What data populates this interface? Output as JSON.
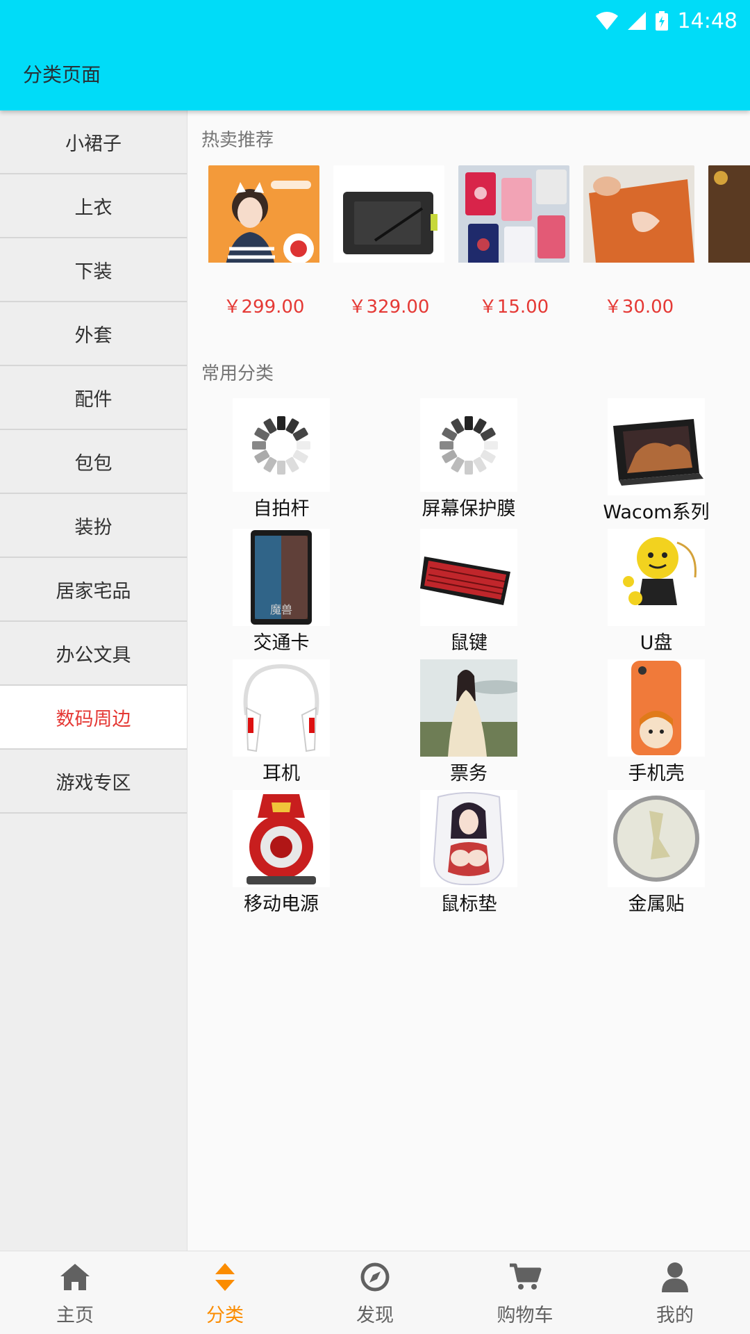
{
  "status_bar": {
    "time": "14:48"
  },
  "app_bar": {
    "title": "分类页面"
  },
  "sidebar": {
    "items": [
      {
        "label": "小裙子",
        "active": false
      },
      {
        "label": "上衣",
        "active": false
      },
      {
        "label": "下装",
        "active": false
      },
      {
        "label": "外套",
        "active": false
      },
      {
        "label": "配件",
        "active": false
      },
      {
        "label": "包包",
        "active": false
      },
      {
        "label": "装扮",
        "active": false
      },
      {
        "label": "居家宅品",
        "active": false
      },
      {
        "label": "办公文具",
        "active": false
      },
      {
        "label": "数码周边",
        "active": true
      },
      {
        "label": "游戏专区",
        "active": false
      }
    ]
  },
  "hot": {
    "title": "热卖推荐",
    "items": [
      {
        "image": "girl-headphones-photo",
        "price": "￥299.00"
      },
      {
        "image": "drawing-tablet-photo",
        "price": "￥329.00"
      },
      {
        "image": "card-holders-photo",
        "price": "￥15.00"
      },
      {
        "image": "orange-notebook-photo",
        "price": "￥30.00"
      },
      {
        "image": "dark-product-photo",
        "price": "￥"
      }
    ]
  },
  "categories": {
    "title": "常用分类",
    "items": [
      {
        "label": "自拍杆",
        "image": "loading-spinner-icon"
      },
      {
        "label": "屏幕保护膜",
        "image": "loading-spinner-icon"
      },
      {
        "label": "Wacom系列",
        "image": "pen-display-photo"
      },
      {
        "label": "交通卡",
        "image": "warcraft-card-photo"
      },
      {
        "label": "鼠键",
        "image": "keyboard-photo"
      },
      {
        "label": "U盘",
        "image": "usb-doll-photo"
      },
      {
        "label": "耳机",
        "image": "neckband-headphones-photo"
      },
      {
        "label": "票务",
        "image": "costume-girl-photo"
      },
      {
        "label": "手机壳",
        "image": "phone-case-photo"
      },
      {
        "label": "移动电源",
        "image": "ironman-powerbank-photo"
      },
      {
        "label": "鼠标垫",
        "image": "anime-mousepad-photo"
      },
      {
        "label": "金属贴",
        "image": "metal-sticker-photo"
      }
    ]
  },
  "bottom_nav": {
    "items": [
      {
        "label": "主页",
        "icon": "home-icon",
        "active": false
      },
      {
        "label": "分类",
        "icon": "sort-icon",
        "active": true
      },
      {
        "label": "发现",
        "icon": "compass-icon",
        "active": false
      },
      {
        "label": "购物车",
        "icon": "cart-icon",
        "active": false
      },
      {
        "label": "我的",
        "icon": "user-icon",
        "active": false
      }
    ]
  },
  "colors": {
    "app_bar": "#00dcf8",
    "accent_red": "#e53935",
    "accent_orange": "#fb8c00"
  }
}
